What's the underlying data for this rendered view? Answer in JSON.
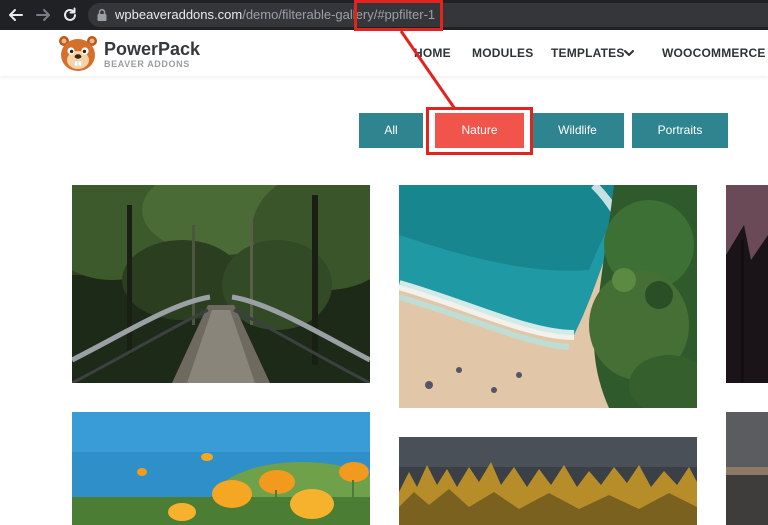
{
  "browser": {
    "url_host": "wpbeaveraddons.com",
    "url_path": "/demo/filterable-gallery/#ppfilter-1",
    "back_icon": "back-arrow-icon",
    "forward_icon": "forward-arrow-icon",
    "reload_icon": "reload-icon",
    "lock_icon": "lock-icon"
  },
  "site": {
    "logo_title": "PowerPack",
    "logo_subtitle": "BEAVER ADDONS",
    "logo_icon": "beaver-logo-icon",
    "menu": [
      "HOME",
      "MODULES",
      "TEMPLATES",
      "WOOCOMMERCE"
    ],
    "menu_dropdown_icon": "chevron-down-icon"
  },
  "filters": {
    "items": [
      "All",
      "Nature",
      "Wildlife",
      "Portraits"
    ],
    "active_index": 1,
    "color": "#2e8590",
    "active_color": "#f1544a"
  },
  "annotation": {
    "color": "#e3231d"
  },
  "gallery": {
    "images": [
      "forest-bridge",
      "aerial-beach",
      "palm-silhouette",
      "orange-poppies",
      "forest-treeline",
      "dusk-coast"
    ]
  }
}
